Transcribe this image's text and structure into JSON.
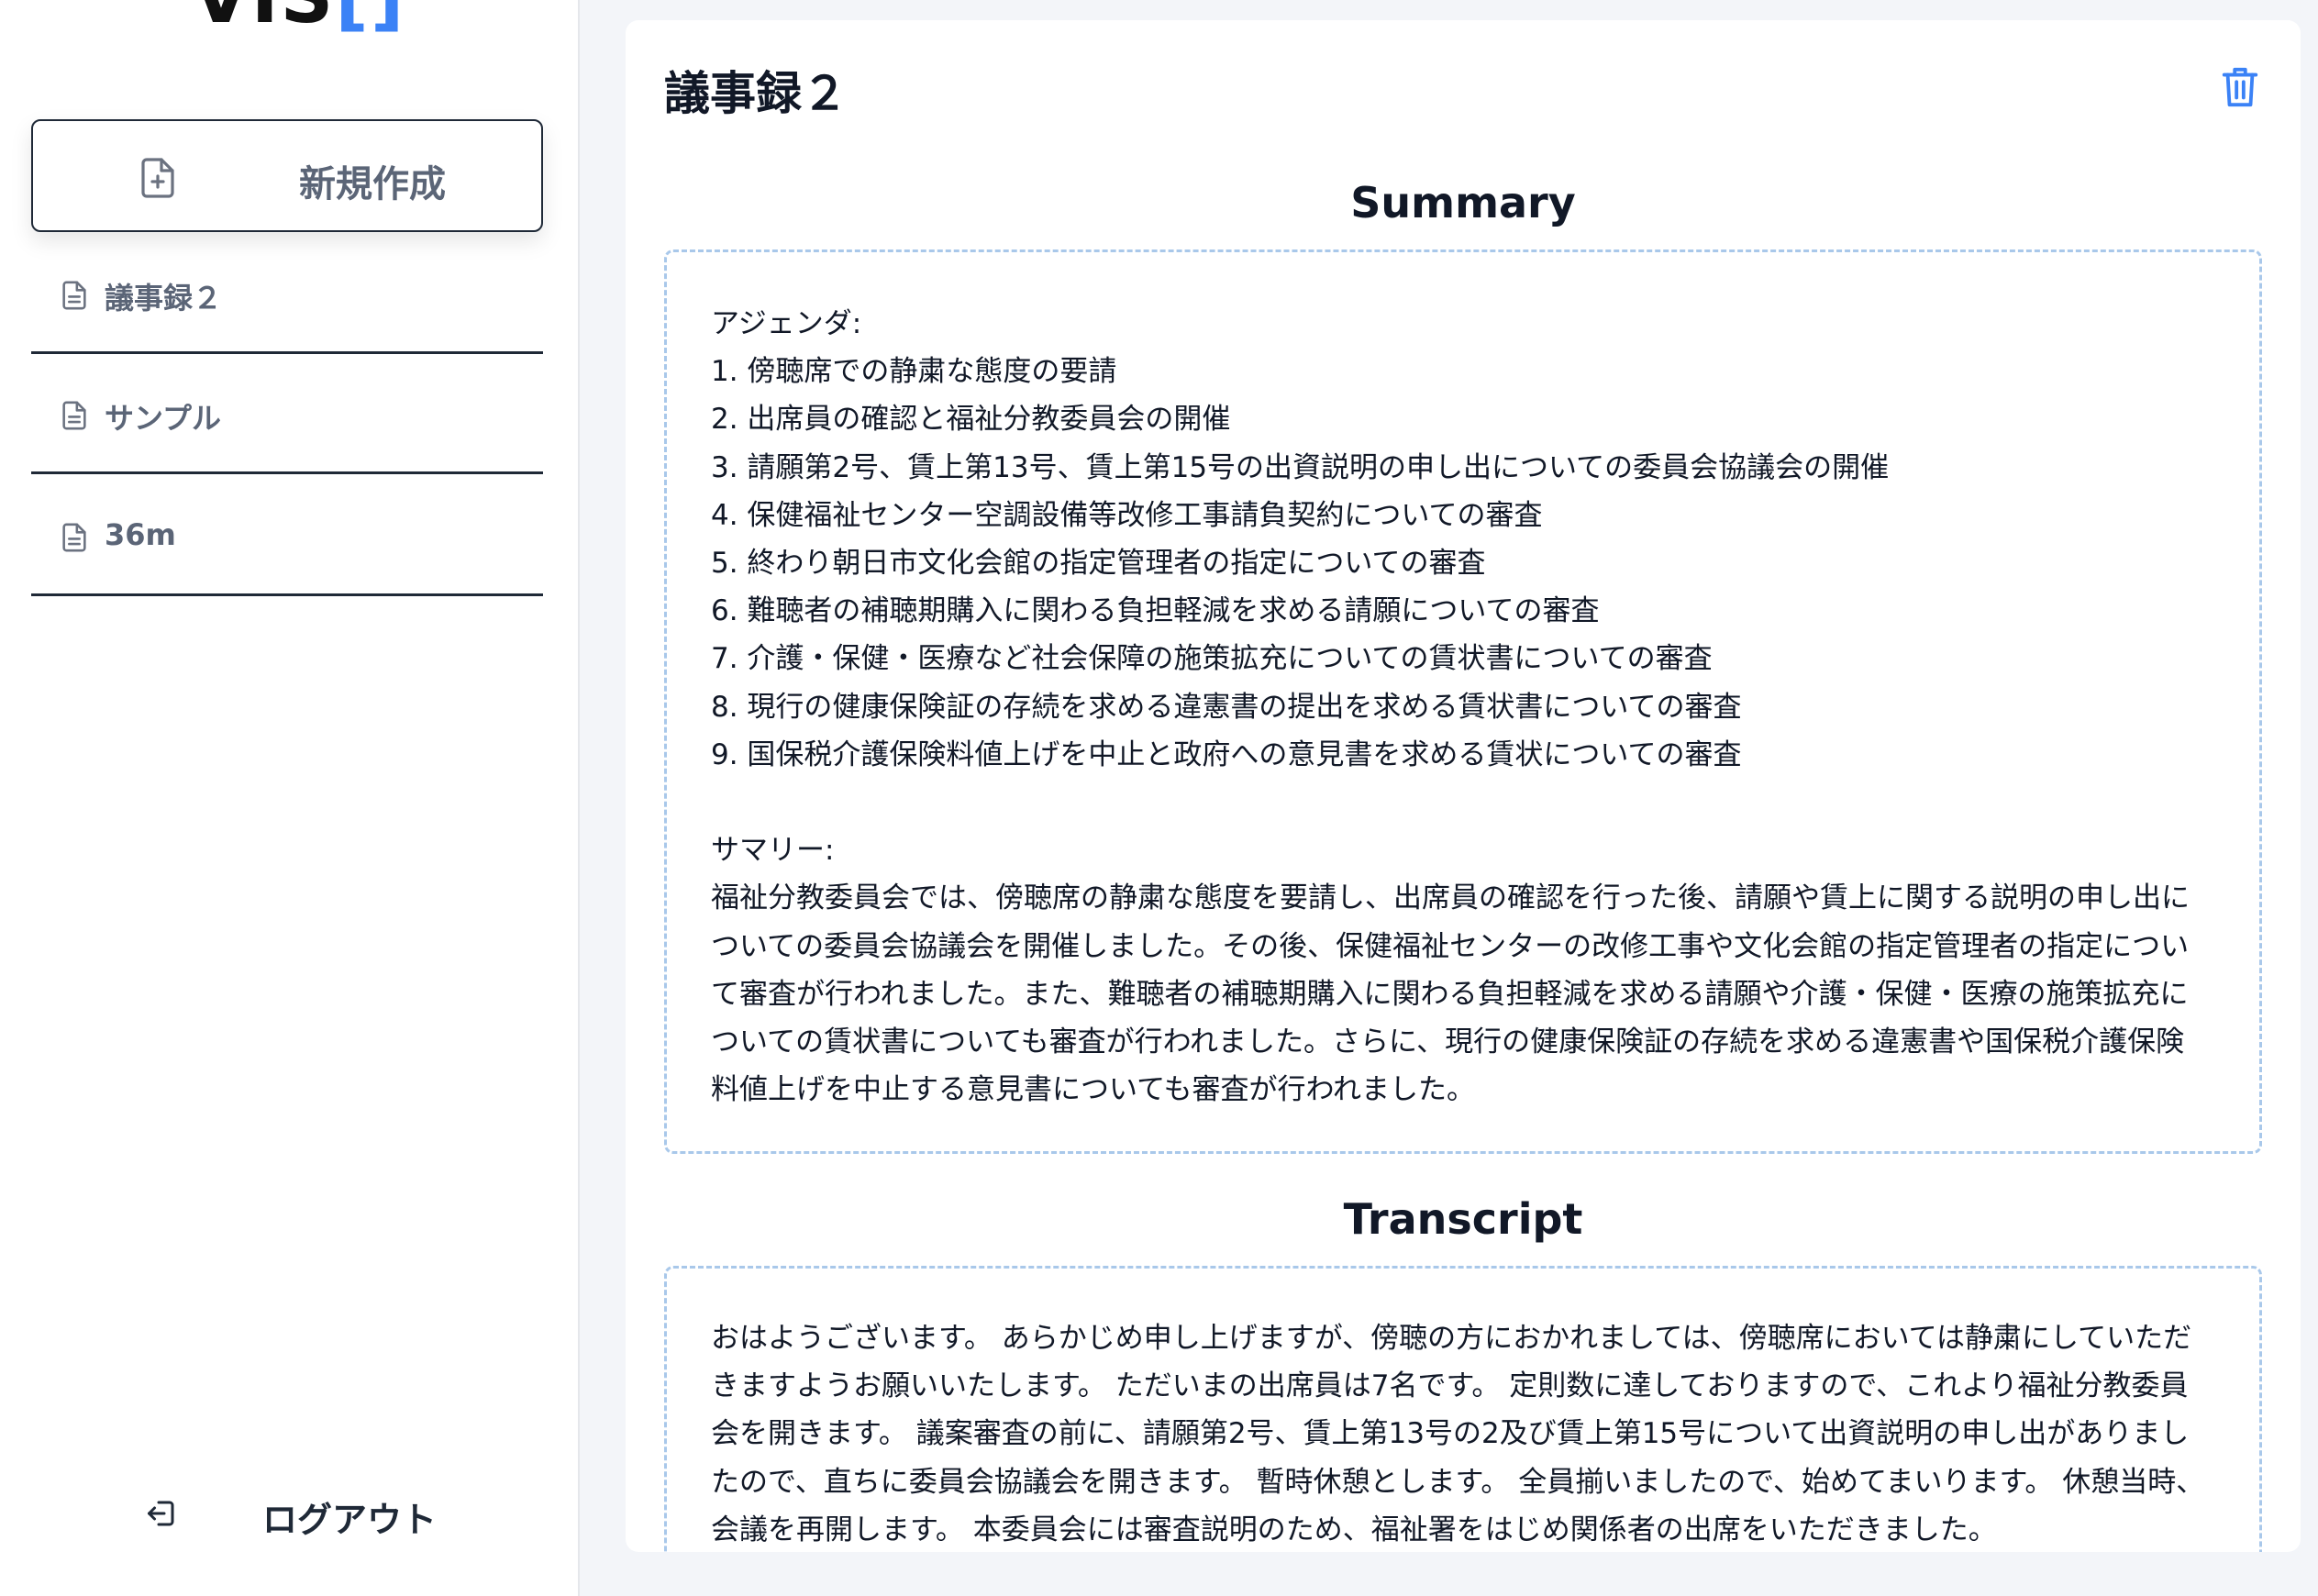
{
  "sidebar": {
    "logo_text": "VIS",
    "logo_bracket": "[]",
    "new_button_label": "新規作成",
    "new_button_icon": "file-plus-icon",
    "items": [
      {
        "label": "議事録２",
        "icon": "document-icon"
      },
      {
        "label": "サンプル",
        "icon": "document-icon"
      },
      {
        "label": "36m",
        "icon": "document-icon"
      }
    ],
    "logout_label": "ログアウト",
    "logout_icon": "logout-icon"
  },
  "main": {
    "title": "議事録２",
    "delete_icon": "trash-icon",
    "summary_heading": "Summary",
    "summary_text": "アジェンダ:\n1. 傍聴席での静粛な態度の要請\n2. 出席員の確認と福祉分教委員会の開催\n3. 請願第2号、賃上第13号、賃上第15号の出資説明の申し出についての委員会協議会の開催\n4. 保健福祉センター空調設備等改修工事請負契約についての審査\n5. 終わり朝日市文化会館の指定管理者の指定についての審査\n6. 難聴者の補聴期購入に関わる負担軽減を求める請願についての審査\n7. 介護・保健・医療など社会保障の施策拡充についての賃状書についての審査\n8. 現行の健康保険証の存続を求める違憲書の提出を求める賃状書についての審査\n9. 国保税介護保険料値上げを中止と政府への意見書を求める賃状についての審査\n\nサマリー:\n福祉分教委員会では、傍聴席の静粛な態度を要請し、出席員の確認を行った後、請願や賃上に関する説明の申し出についての委員会協議会を開催しました。その後、保健福祉センターの改修工事や文化会館の指定管理者の指定について審査が行われました。また、難聴者の補聴期購入に関わる負担軽減を求める請願や介護・保健・医療の施策拡充についての賃状書についても審査が行われました。さらに、現行の健康保険証の存続を求める違憲書や国保税介護保険料値上げを中止する意見書についても審査が行われました。",
    "transcript_heading": "Transcript",
    "transcript_text": "おはようございます。 あらかじめ申し上げますが、傍聴の方におかれましては、傍聴席においては静粛にしていただきますようお願いいたします。 ただいまの出席員は7名です。 定則数に達しておりますので、これより福祉分教委員会を開きます。 議案審査の前に、請願第2号、賃上第13号の2及び賃上第15号について出資説明の申し出がありましたので、直ちに委員会協議会を開きます。 暫時休憩とします。 全員揃いましたので、始めてまいります。 休憩当時、会議を再開します。 本委員会には審査説明のため、福祉署をはじめ関係者の出席をいただきました。"
  }
}
